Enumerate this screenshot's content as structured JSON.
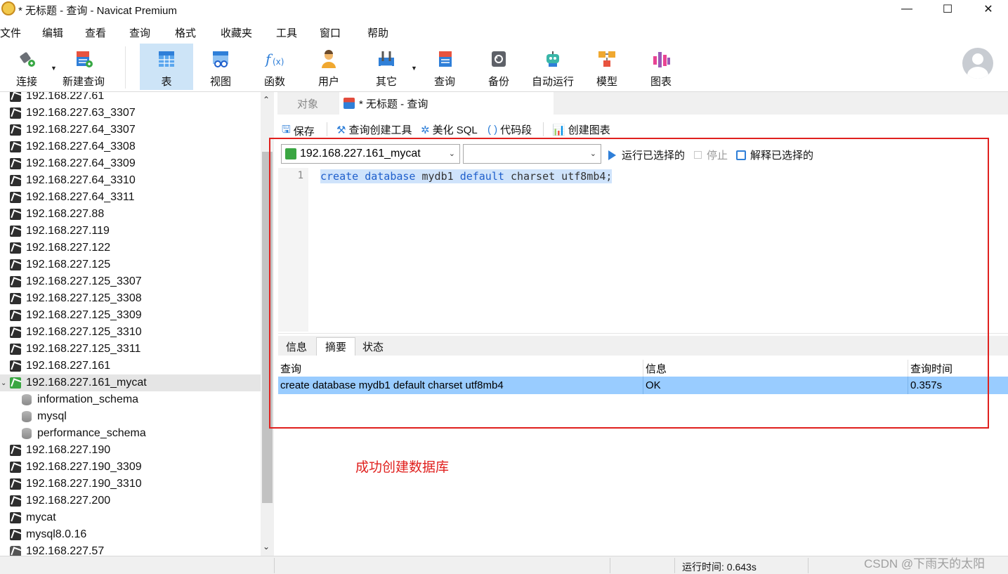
{
  "window": {
    "title": "* 无标题 - 查询 - Navicat Premium",
    "minimize": "—",
    "maximize": "☐",
    "close": "✕"
  },
  "menu": [
    "文件",
    "编辑",
    "查看",
    "查询",
    "格式",
    "收藏夹",
    "工具",
    "窗口",
    "帮助"
  ],
  "toolbar": {
    "connect": "连接",
    "new_query": "新建查询",
    "table": "表",
    "view": "视图",
    "function": "函数",
    "user": "用户",
    "other": "其它",
    "query": "查询",
    "backup": "备份",
    "automation": "自动运行",
    "model": "模型",
    "chart": "图表",
    "active": "表"
  },
  "tree": {
    "items": [
      {
        "label": "192.168.227.61",
        "type": "conn"
      },
      {
        "label": "192.168.227.63_3307",
        "type": "conn"
      },
      {
        "label": "192.168.227.64_3307",
        "type": "conn"
      },
      {
        "label": "192.168.227.64_3308",
        "type": "conn"
      },
      {
        "label": "192.168.227.64_3309",
        "type": "conn"
      },
      {
        "label": "192.168.227.64_3310",
        "type": "conn"
      },
      {
        "label": "192.168.227.64_3311",
        "type": "conn"
      },
      {
        "label": "192.168.227.88",
        "type": "conn"
      },
      {
        "label": "192.168.227.119",
        "type": "conn"
      },
      {
        "label": "192.168.227.122",
        "type": "conn"
      },
      {
        "label": "192.168.227.125",
        "type": "conn"
      },
      {
        "label": "192.168.227.125_3307",
        "type": "conn"
      },
      {
        "label": "192.168.227.125_3308",
        "type": "conn"
      },
      {
        "label": "192.168.227.125_3309",
        "type": "conn"
      },
      {
        "label": "192.168.227.125_3310",
        "type": "conn"
      },
      {
        "label": "192.168.227.125_3311",
        "type": "conn"
      },
      {
        "label": "192.168.227.161",
        "type": "conn"
      },
      {
        "label": "192.168.227.161_mycat",
        "type": "conn-open",
        "selected": true
      },
      {
        "label": "information_schema",
        "type": "db"
      },
      {
        "label": "mysql",
        "type": "db"
      },
      {
        "label": "performance_schema",
        "type": "db"
      },
      {
        "label": "192.168.227.190",
        "type": "conn"
      },
      {
        "label": "192.168.227.190_3309",
        "type": "conn"
      },
      {
        "label": "192.168.227.190_3310",
        "type": "conn"
      },
      {
        "label": "192.168.227.200",
        "type": "conn"
      },
      {
        "label": "mycat",
        "type": "conn"
      },
      {
        "label": "mysql8.0.16",
        "type": "conn"
      },
      {
        "label": "192.168.227.57",
        "type": "pg"
      }
    ]
  },
  "tabs": {
    "objects": "对象",
    "query": "* 无标题 - 查询"
  },
  "query_toolbar": {
    "save": "保存",
    "builder": "查询创建工具",
    "beautify": "美化 SQL",
    "snippet": "代码段",
    "create_chart": "创建图表"
  },
  "run_bar": {
    "connection": "192.168.227.161_mycat",
    "database": "",
    "run_selected": "运行已选择的",
    "stop": "停止",
    "explain": "解释已选择的"
  },
  "editor": {
    "line_number": "1",
    "kw1": "create",
    "kw2": "database",
    "ident": "mydb1",
    "kw3": "default",
    "rest": "charset utf8mb4;"
  },
  "results": {
    "tabs": [
      "信息",
      "摘要",
      "状态"
    ],
    "active_tab": "摘要",
    "columns": [
      "查询",
      "信息",
      "查询时间"
    ],
    "rows": [
      [
        "create database mydb1 default charset utf8mb4",
        "OK",
        "0.357s"
      ]
    ]
  },
  "annotation": "成功创建数据库",
  "status": {
    "run_time": "运行时间: 0.643s"
  },
  "watermark": "CSDN @下雨天的太阳",
  "colors": {
    "accent": "#2f7fd8",
    "selected_row": "#99ccff",
    "annotation_red": "#e0201e",
    "active_tool": "#cde4f7"
  }
}
